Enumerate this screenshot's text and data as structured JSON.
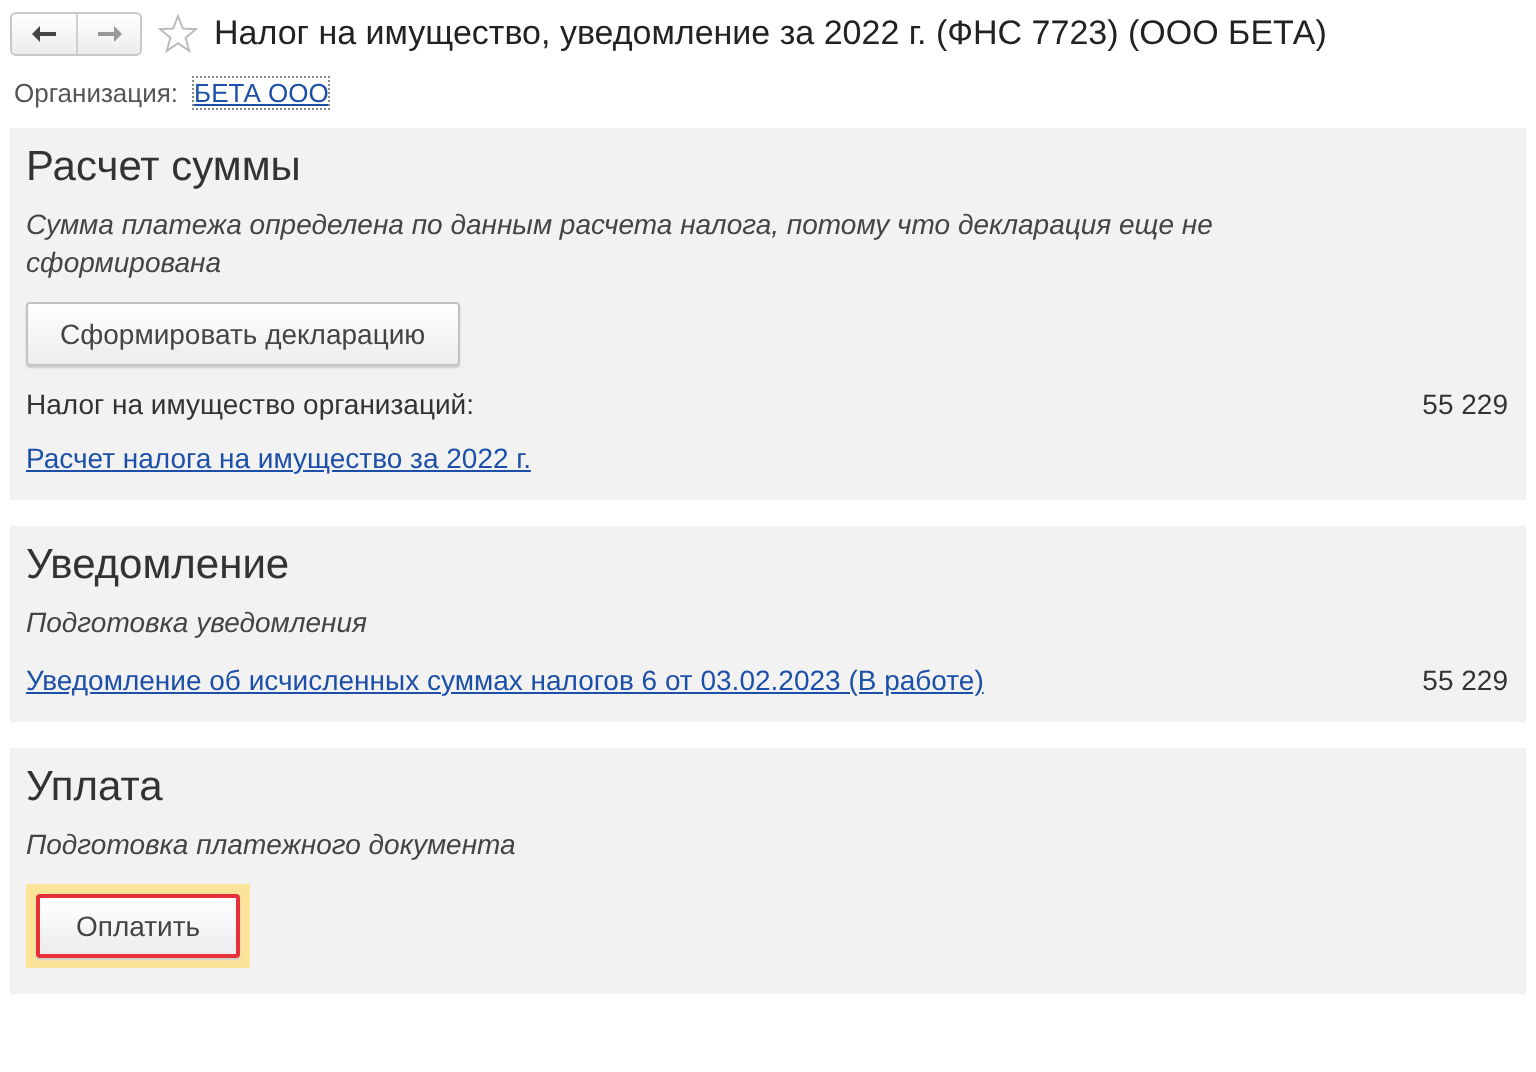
{
  "window": {
    "title": "Налог на имущество, уведомление за 2022 г. (ФНС 7723) (ООО БЕТА)",
    "favorite": false
  },
  "organization": {
    "label": "Организация:",
    "value": "БЕТА ООО"
  },
  "sections": [
    {
      "title": "Расчет суммы",
      "note": "Сумма платежа определена по данным расчета налога, потому что декларация еще не сформирована",
      "rows": [
        {
          "kind": "button",
          "label": "Сформировать декларацию",
          "highlighted": false
        },
        {
          "kind": "text",
          "label": "Налог на имущество организаций:",
          "value": "55 229"
        },
        {
          "kind": "link",
          "label": "Расчет налога на имущество за 2022 г."
        }
      ]
    },
    {
      "title": "Уведомление",
      "note": "Подготовка уведомления",
      "rows": [
        {
          "kind": "link",
          "label": "Уведомление об исчисленных суммах налогов 6 от 03.02.2023 (В работе)",
          "value": "55 229"
        }
      ]
    },
    {
      "title": "Уплата",
      "note": "Подготовка платежного документа",
      "rows": [
        {
          "kind": "button",
          "label": "Оплатить",
          "highlighted": true
        }
      ]
    }
  ]
}
